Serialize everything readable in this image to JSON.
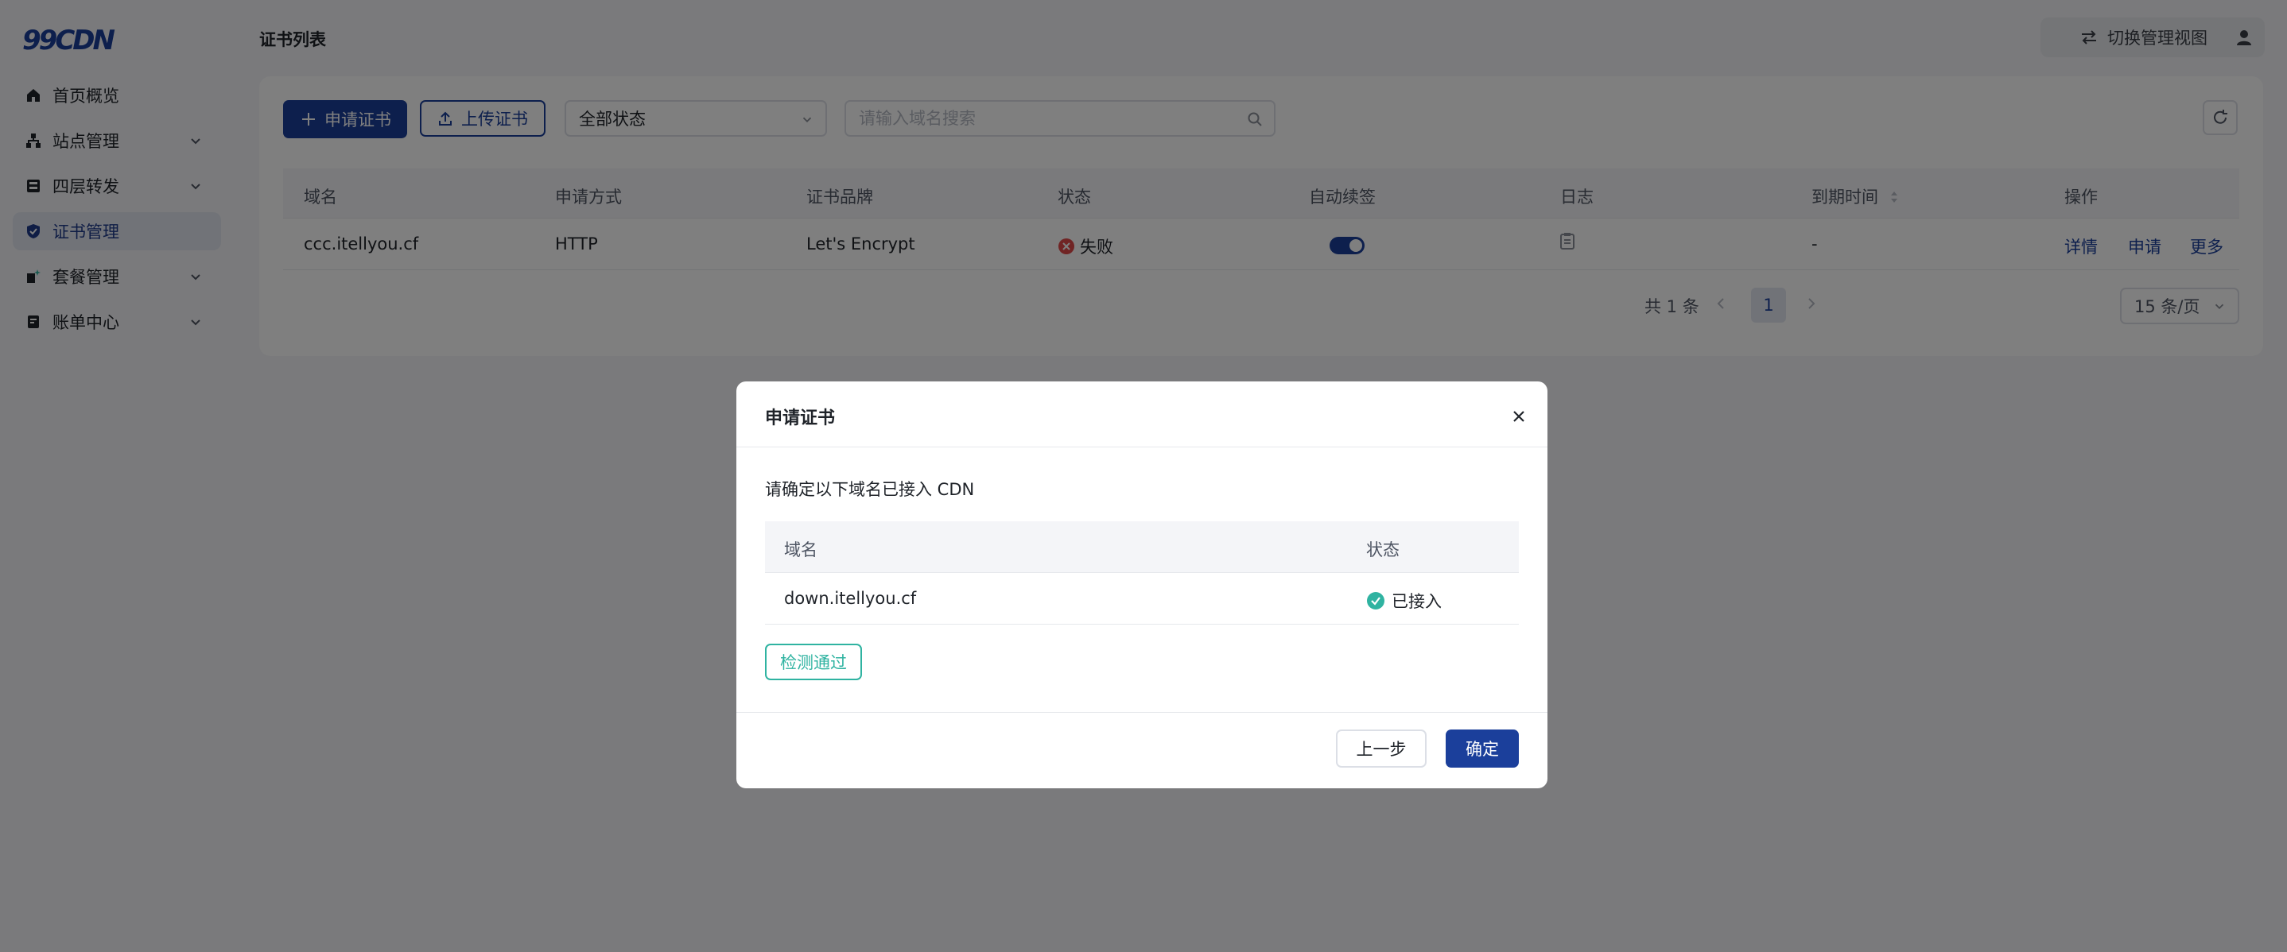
{
  "brand": {
    "logo_text": "99CDN",
    "accent": "#1b3f9b",
    "success": "#2fb3a1",
    "error": "#e04848"
  },
  "sidebar": {
    "items": [
      {
        "label": "首页概览",
        "icon": "home-icon",
        "expandable": false,
        "active": false
      },
      {
        "label": "站点管理",
        "icon": "sitemap-icon",
        "expandable": true,
        "active": false
      },
      {
        "label": "四层转发",
        "icon": "forward-icon",
        "expandable": true,
        "active": false
      },
      {
        "label": "证书管理",
        "icon": "shield-icon",
        "expandable": false,
        "active": true
      },
      {
        "label": "套餐管理",
        "icon": "package-icon",
        "expandable": true,
        "active": false
      },
      {
        "label": "账单中心",
        "icon": "bill-icon",
        "expandable": true,
        "active": false
      }
    ]
  },
  "header": {
    "title": "证书列表",
    "switch_view_label": "切换管理视图"
  },
  "toolbar": {
    "apply_label": "申请证书",
    "upload_label": "上传证书",
    "status_filter_value": "全部状态",
    "search_placeholder": "请输入域名搜索"
  },
  "table": {
    "columns": [
      "域名",
      "申请方式",
      "证书品牌",
      "状态",
      "自动续签",
      "日志",
      "到期时间",
      "操作"
    ],
    "rows": [
      {
        "domain": "ccc.itellyou.cf",
        "method": "HTTP",
        "brand": "Let's Encrypt",
        "status": "失败",
        "auto_renew": true,
        "expire": "-",
        "actions": [
          "详情",
          "申请",
          "更多"
        ]
      }
    ]
  },
  "pagination": {
    "total_text": "共 1 条",
    "current_page": "1",
    "page_size": "15 条/页"
  },
  "modal": {
    "title": "申请证书",
    "description": "请确定以下域名已接入 CDN",
    "columns": [
      "域名",
      "状态"
    ],
    "rows": [
      {
        "domain": "down.itellyou.cf",
        "status": "已接入"
      }
    ],
    "check_label": "检测通过",
    "back_label": "上一步",
    "confirm_label": "确定"
  }
}
